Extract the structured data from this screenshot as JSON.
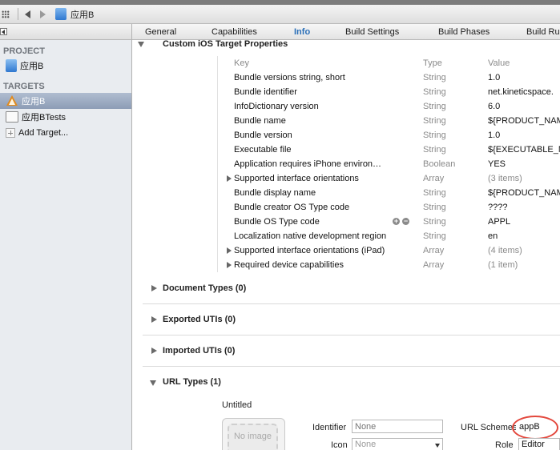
{
  "jumpbar": {
    "title": "应用B"
  },
  "sidebar": {
    "project_header": "PROJECT",
    "project_item": "应用B",
    "targets_header": "TARGETS",
    "targets": [
      {
        "label": "应用B",
        "selected": true
      },
      {
        "label": "应用BTests",
        "selected": false
      },
      {
        "label": "Add Target...",
        "selected": false
      }
    ]
  },
  "tabs": [
    "General",
    "Capabilities",
    "Info",
    "Build Settings",
    "Build Phases",
    "Build Ru"
  ],
  "active_tab": "Info",
  "custom_props": {
    "title": "Custom iOS Target Properties",
    "headers": {
      "key": "Key",
      "type": "Type",
      "value": "Value"
    },
    "rows": [
      {
        "key": "Bundle versions string, short",
        "type": "String",
        "value": "1.0"
      },
      {
        "key": "Bundle identifier",
        "type": "String",
        "value": "net.kineticspace."
      },
      {
        "key": "InfoDictionary version",
        "type": "String",
        "value": "6.0"
      },
      {
        "key": "Bundle name",
        "type": "String",
        "value": "${PRODUCT_NAME}"
      },
      {
        "key": "Bundle version",
        "type": "String",
        "value": "1.0"
      },
      {
        "key": "Executable file",
        "type": "String",
        "value": "${EXECUTABLE_NAME}"
      },
      {
        "key": "Application requires iPhone environ…",
        "type": "Boolean",
        "value": "YES"
      },
      {
        "key": "Supported interface orientations",
        "type": "Array",
        "value": "(3 items)"
      },
      {
        "key": "Bundle display name",
        "type": "String",
        "value": "${PRODUCT_NAME}"
      },
      {
        "key": "Bundle creator OS Type code",
        "type": "String",
        "value": "????"
      },
      {
        "key": "Bundle OS Type code",
        "type": "String",
        "value": "APPL"
      },
      {
        "key": "Localization native development region",
        "type": "String",
        "value": "en"
      },
      {
        "key": "Supported interface orientations (iPad)",
        "type": "Array",
        "value": "(4 items)"
      },
      {
        "key": "Required device capabilities",
        "type": "Array",
        "value": "(1 item)"
      }
    ]
  },
  "sections": {
    "document_types": "Document Types (0)",
    "exported_utis": "Exported UTIs (0)",
    "imported_utis": "Imported UTIs (0)",
    "url_types": "URL Types (1)"
  },
  "url_type": {
    "name": "Untitled",
    "image_placeholder": "No image",
    "identifier_label": "Identifier",
    "identifier_placeholder": "None",
    "icon_label": "Icon",
    "icon_value": "None",
    "url_schemes_label": "URL Schemes",
    "url_schemes_value": "appB",
    "role_label": "Role",
    "role_value": "Editor"
  },
  "colors": {
    "accent": "#2a6fb8",
    "selection": "#8d9db6",
    "annotation": "#e3473c"
  }
}
